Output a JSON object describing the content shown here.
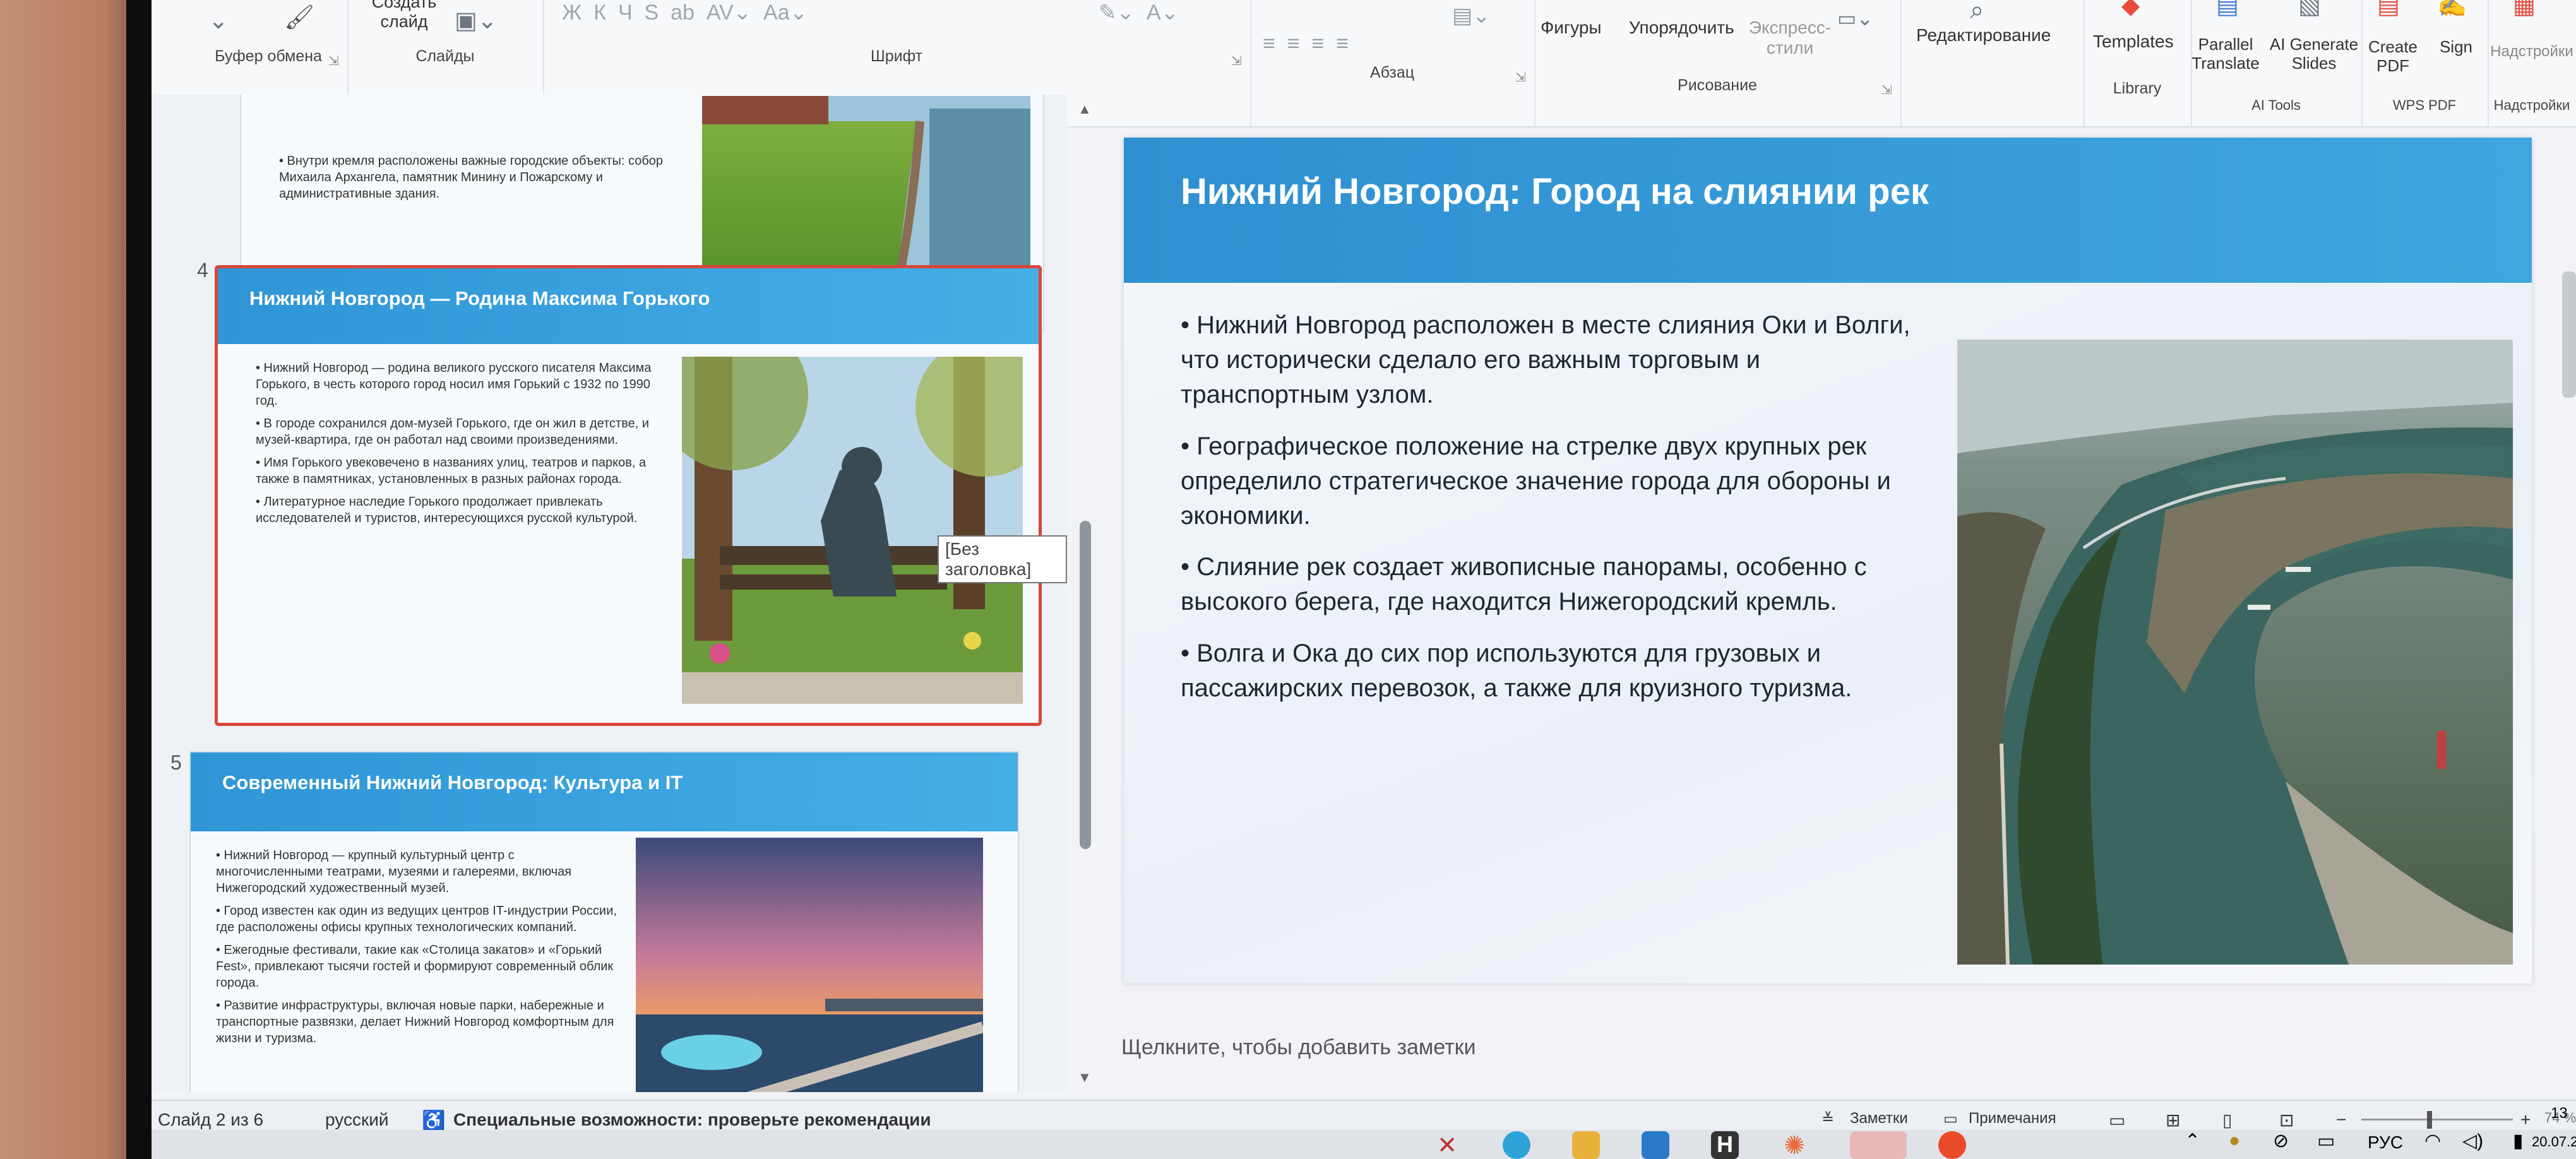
{
  "ribbon": {
    "clipboard_label": "Буфер обмена",
    "slides_label": "Слайды",
    "create_slide_label": "Создать слайд",
    "font_label": "Шрифт",
    "paragraph_label": "Абзац",
    "drawing_label": "Рисование",
    "shapes_label": "Фигуры",
    "arrange_label": "Упорядочить",
    "quick_styles_label": "Экспресс-стили",
    "editing_label": "Редактирование",
    "templates_label": "Templates",
    "library_label": "Library",
    "parallel_translate_label": "Parallel Translate",
    "ai_generate_label": "AI Generate Slides",
    "ai_tools_label": "AI Tools",
    "create_pdf_label": "Create PDF",
    "sign_label": "Sign",
    "wps_pdf_label": "WPS PDF",
    "addins_label": "Надстройки",
    "addins_group_label": "Надстройки"
  },
  "thumbnails": {
    "slide3_partial_text": "• Внутри кремля расположены важные городские объекты: собор Михаила Архангела, памятник Минину и Пожарскому и административные здания.",
    "slide4": {
      "number": "4",
      "title": "Нижний Новгород — Родина Максима Горького",
      "bullets": [
        "• Нижний Новгород — родина великого русского писателя Максима Горького, в честь которого город носил имя Горький с 1932 по 1990 год.",
        "• В городе сохранился дом-музей Горького, где он жил в детстве, и музей-квартира, где он работал над своими произведениями.",
        "• Имя Горького увековечено в названиях улиц, театров и парков, а также в памятниках, установленных в разных районах города.",
        "• Литературное наследие Горького продолжает привлекать исследователей и туристов, интересующихся русской культурой."
      ],
      "tooltip": "[Без заголовка]"
    },
    "slide5": {
      "number": "5",
      "title": "Современный Нижний Новгород: Культура и IT",
      "bullets": [
        "• Нижний Новгород — крупный культурный центр с многочисленными театрами, музеями и галереями, включая Нижегородский художественный музей.",
        "• Город известен как один из ведущих центров IT-индустрии России, где расположены офисы крупных технологических компаний.",
        "• Ежегодные фестивали, такие как «Столица закатов» и «Горький Fest», привлекают тысячи гостей и формируют современный облик города.",
        "• Развитие инфраструктуры, включая новые парки, набережные и транспортные развязки, делает Нижний Новгород комфортным для жизни и туризма."
      ]
    }
  },
  "slide": {
    "title": "Нижний Новгород: Город на слиянии рек",
    "bullets": [
      "• Нижний Новгород расположен в месте слияния Оки и Волги, что исторически сделало его важным торговым и транспортным узлом.",
      "• Географическое положение на стрелке двух крупных рек определило стратегическое значение города для обороны и экономики.",
      "• Слияние рек создает живописные панорамы, особенно с высокого берега, где находится Нижегородский кремль.",
      "• Волга и Ока до сих пор используются для грузовых и пассажирских перевозок, а также для круизного туризма."
    ]
  },
  "notes": {
    "placeholder": "Щелкните, чтобы добавить заметки"
  },
  "status": {
    "slide_counter": "Слайд 2 из 6",
    "language": "русский",
    "accessibility": "Специальные возможности: проверьте рекомендации",
    "notes_btn": "Заметки",
    "comments_btn": "Примечания",
    "zoom": "74 %",
    "lang_indicator": "РУС",
    "clock_time": "13",
    "clock_date": "20.07.2"
  },
  "colors": {
    "header_blue": "#3a9fdc",
    "selection_red": "#d9463a"
  }
}
